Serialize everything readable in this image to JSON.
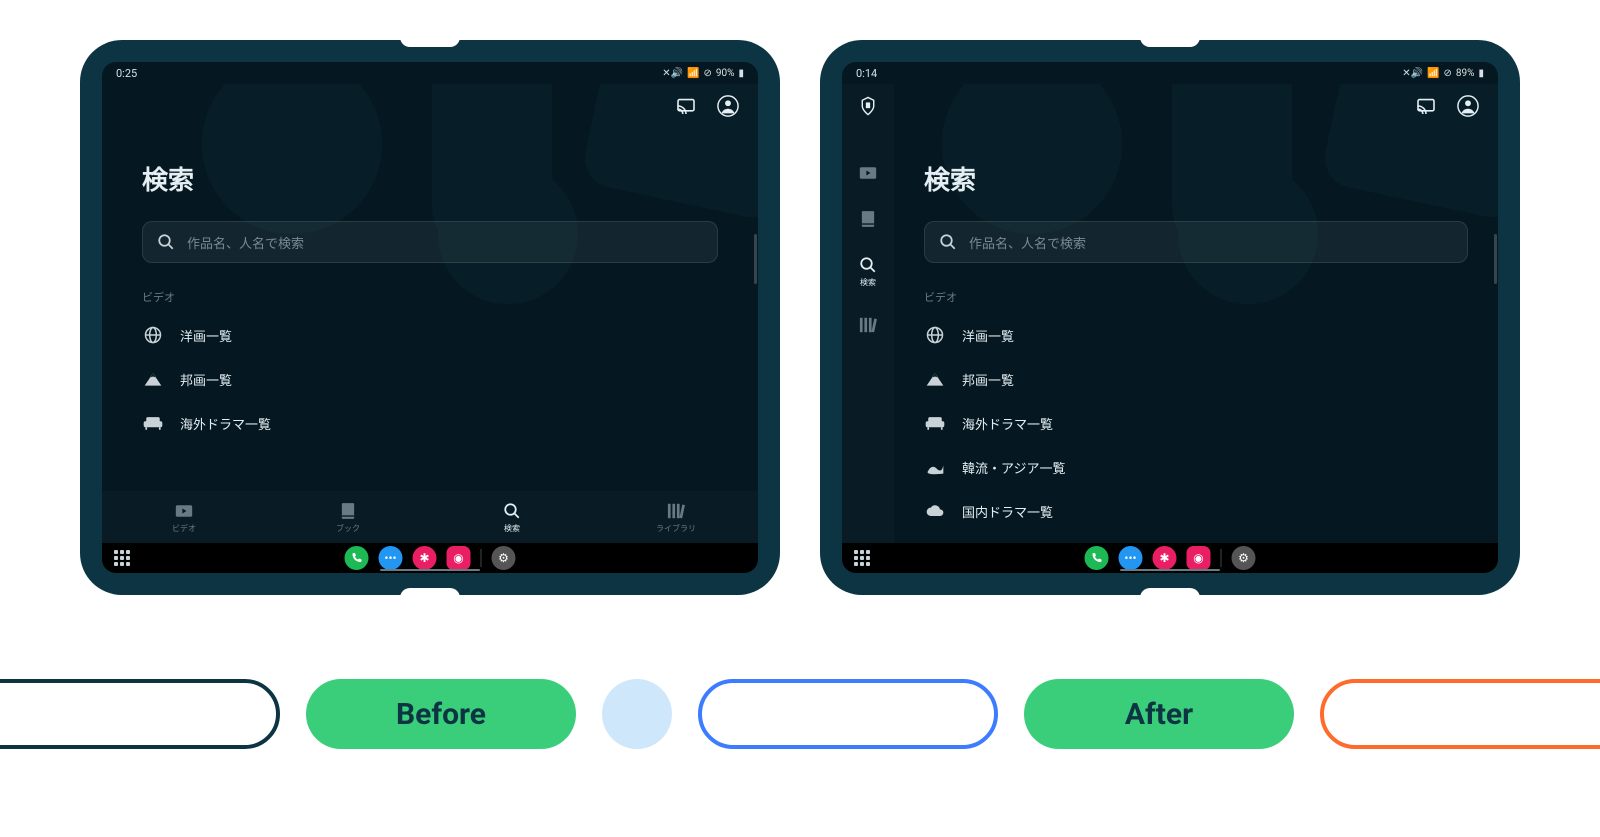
{
  "labels": {
    "before": "Before",
    "after": "After"
  },
  "before": {
    "status": {
      "time": "0:25",
      "battery": "90%"
    },
    "title": "検索",
    "search_placeholder": "作品名、人名で検索",
    "section": "ビデオ",
    "categories": [
      {
        "icon": "globe",
        "label": "洋画一覧"
      },
      {
        "icon": "mountain",
        "label": "邦画一覧"
      },
      {
        "icon": "sofa",
        "label": "海外ドラマ一覧"
      }
    ],
    "bottom_nav": [
      {
        "icon": "video",
        "label": "ビデオ"
      },
      {
        "icon": "book",
        "label": "ブック"
      },
      {
        "icon": "search",
        "label": "検索",
        "active": true
      },
      {
        "icon": "library",
        "label": "ライブラリ"
      }
    ]
  },
  "after": {
    "status": {
      "time": "0:14",
      "battery": "89%"
    },
    "title": "検索",
    "search_placeholder": "作品名、人名で検索",
    "section": "ビデオ",
    "categories": [
      {
        "icon": "globe",
        "label": "洋画一覧"
      },
      {
        "icon": "mountain",
        "label": "邦画一覧"
      },
      {
        "icon": "sofa",
        "label": "海外ドラマ一覧"
      },
      {
        "icon": "wave",
        "label": "韓流・アジア一覧"
      },
      {
        "icon": "cloud",
        "label": "国内ドラマ一覧"
      }
    ],
    "side_nav": [
      {
        "icon": "video",
        "label": ""
      },
      {
        "icon": "book",
        "label": ""
      },
      {
        "icon": "search",
        "label": "検索",
        "active": true
      },
      {
        "icon": "library",
        "label": ""
      }
    ]
  }
}
